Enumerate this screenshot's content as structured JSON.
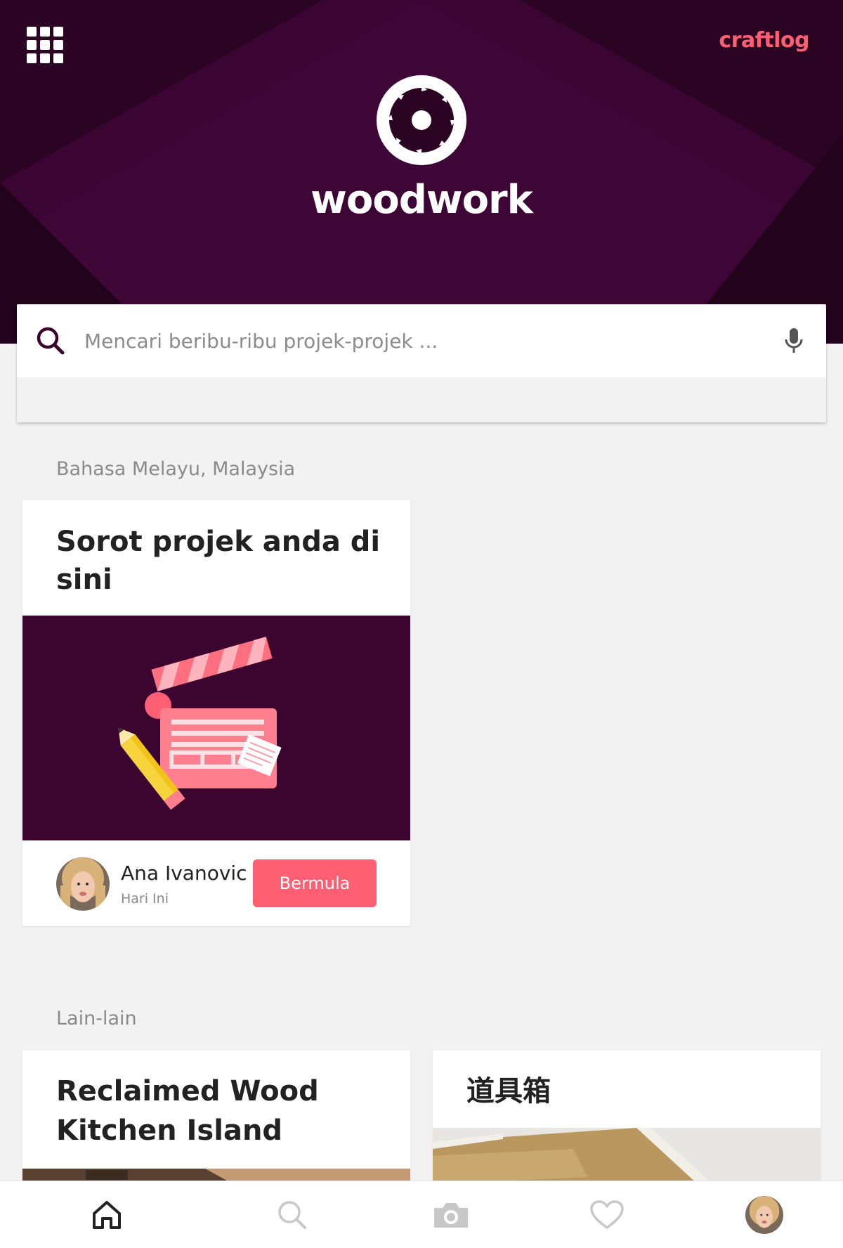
{
  "header": {
    "brand": "craftlog",
    "app_name": "woodwork",
    "apps_icon": "grid-icon",
    "logo_icon": "saw-blade-icon"
  },
  "search": {
    "placeholder": "Mencari beribu-ribu projek-projek ...",
    "value": "",
    "search_icon": "search-icon",
    "mic_icon": "microphone-icon"
  },
  "sections": {
    "locale_label": "Bahasa Melayu, Malaysia",
    "other_label": "Lain-lain"
  },
  "featured": {
    "title": "Sorot projek anda di sini",
    "image_icon": "clapperboard-illustration",
    "author_name": "Ana Ivanovic",
    "author_time": "Hari Ini",
    "cta_label": "Bermula"
  },
  "other_cards": [
    {
      "title": "Reclaimed Wood Kitchen Island"
    },
    {
      "title": "道具箱"
    }
  ],
  "bottom_nav": [
    {
      "name": "home",
      "icon": "home-icon",
      "active": true
    },
    {
      "name": "search",
      "icon": "search-icon",
      "active": false
    },
    {
      "name": "camera",
      "icon": "camera-icon",
      "active": false
    },
    {
      "name": "favorites",
      "icon": "heart-icon",
      "active": false
    },
    {
      "name": "profile",
      "icon": "avatar",
      "active": false
    }
  ],
  "colors": {
    "header_bg": "#2a0422",
    "accent": "#ff5f72",
    "feature_bg": "#3b0530",
    "page_bg": "#f2f2f2"
  }
}
